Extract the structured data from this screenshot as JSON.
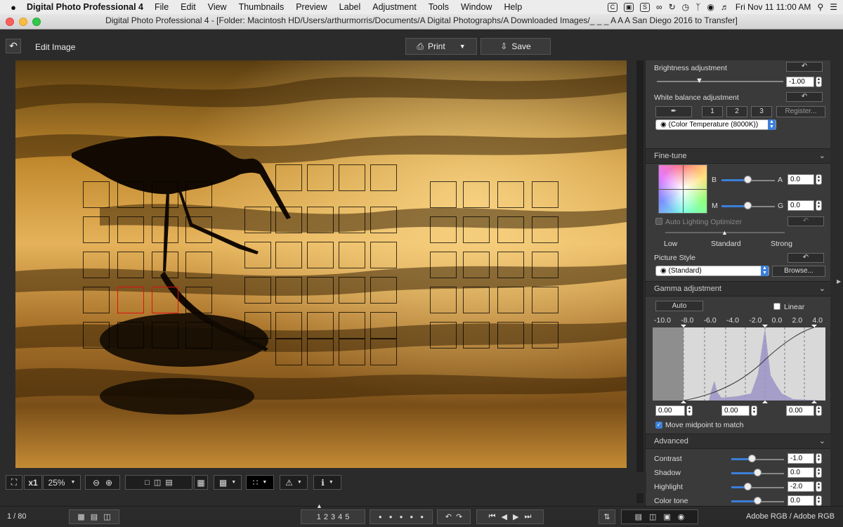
{
  "menubar": {
    "apple": "",
    "app_name": "Digital Photo Professional 4",
    "items": [
      "File",
      "Edit",
      "View",
      "Thumbnails",
      "Preview",
      "Label",
      "Adjustment",
      "Tools",
      "Window",
      "Help"
    ],
    "clock": "Fri Nov 11  11:00 AM"
  },
  "window": {
    "title": "Digital Photo Professional 4 - [Folder: Macintosh HD/Users/arthurmorris/Documents/A Digital Photographs/A Downloaded Images/_ _ _ A A A San Diego 2016 to Transfer]"
  },
  "toolbar": {
    "mode_label": "Edit Image",
    "print_label": "Print",
    "save_label": "Save"
  },
  "panel": {
    "brightness": {
      "label": "Brightness adjustment",
      "value": "-1.00",
      "level": -1.0
    },
    "white_balance": {
      "label": "White balance adjustment",
      "presets": [
        "1",
        "2",
        "3"
      ],
      "register_label": "Register...",
      "mode": "(Color Temperature (8000K))"
    },
    "finetune": {
      "section": "Fine-tune",
      "b_label": "B",
      "a_label": "A",
      "m_label": "M",
      "g_label": "G",
      "a_value": "0.0",
      "g_value": "0.0"
    },
    "alo": {
      "label": "Auto Lighting Optimizer",
      "low": "Low",
      "standard": "Standard",
      "strong": "Strong"
    },
    "picture_style": {
      "label": "Picture Style",
      "value": "(Standard)",
      "browse_label": "Browse..."
    },
    "gamma": {
      "section": "Gamma adjustment",
      "auto_label": "Auto",
      "linear_label": "Linear",
      "scale": [
        "-10.0",
        "-8.0",
        "-6.0",
        "-4.0",
        "-2.0",
        "0.0",
        "2.0",
        "4.0"
      ],
      "black_value": "0.00",
      "mid_value": "0.00",
      "white_value": "0.00",
      "move_midpoint_label": "Move midpoint to match",
      "move_midpoint_checked": true
    },
    "advanced": {
      "section": "Advanced",
      "rows": [
        {
          "label": "Contrast",
          "value": "-1.0"
        },
        {
          "label": "Shadow",
          "value": "0.0"
        },
        {
          "label": "Highlight",
          "value": "-2.0"
        },
        {
          "label": "Color tone",
          "value": "0.0"
        }
      ]
    }
  },
  "viewbar": {
    "zoom_multiplier": "x1",
    "zoom_value": "25%"
  },
  "statusbar": {
    "counter": "1 / 80",
    "ratings": [
      "1",
      "2",
      "3",
      "4",
      "5"
    ],
    "color_space": "Adobe RGB / Adobe RGB"
  },
  "colors": {
    "accent": "#3b7fd9",
    "af_active": "#d11111",
    "panel_bg": "#3a3a3a"
  }
}
